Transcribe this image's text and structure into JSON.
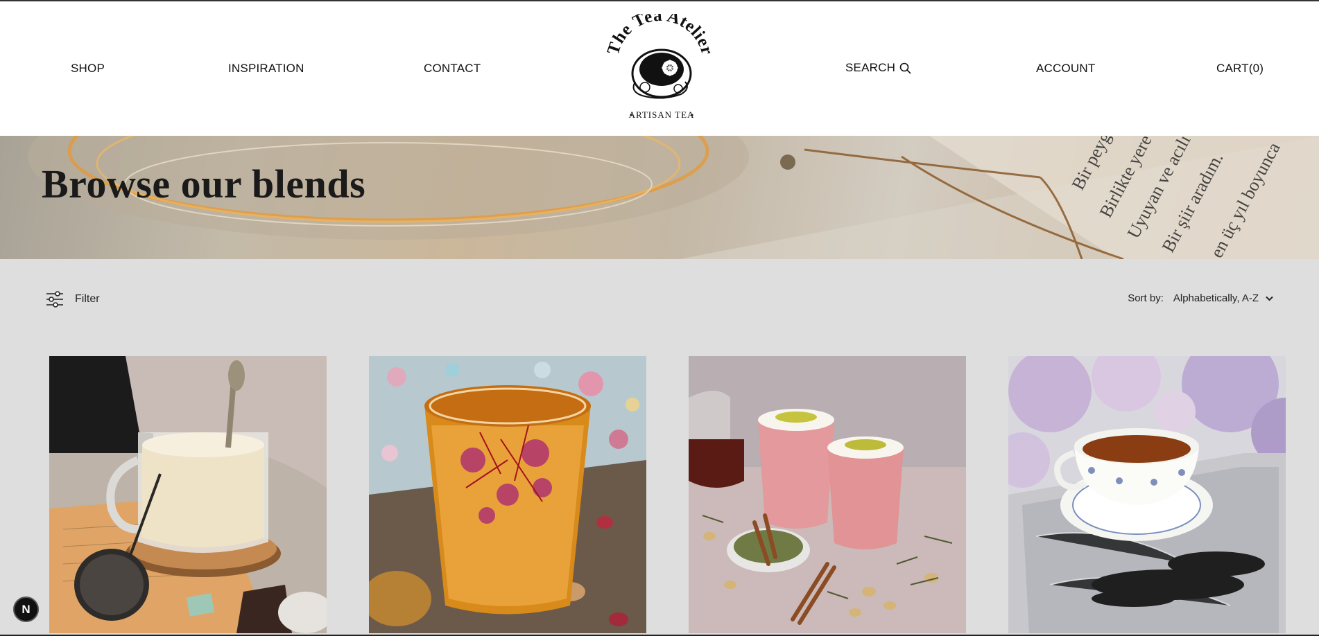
{
  "nav": {
    "shop": "SHOP",
    "inspiration": "INSPIRATION",
    "contact": "CONTACT",
    "search": "SEARCH",
    "account": "ACCOUNT",
    "cart": "CART(0)"
  },
  "logo": {
    "brand": "The Tea Atelier",
    "tagline": "ARTISAN TEA"
  },
  "hero": {
    "title": "Browse our blends"
  },
  "toolbar": {
    "filter_label": "Filter",
    "sort_label": "Sort by:",
    "sort_value": "Alphabetically, A-Z"
  },
  "badge": {
    "letter": "N"
  },
  "colors": {
    "page_bg": "#dedede",
    "header_bg": "#ffffff",
    "text": "#111111"
  },
  "icons": {
    "search": "search-icon",
    "filter": "sliders-icon",
    "sort": "chevron-down-icon"
  }
}
